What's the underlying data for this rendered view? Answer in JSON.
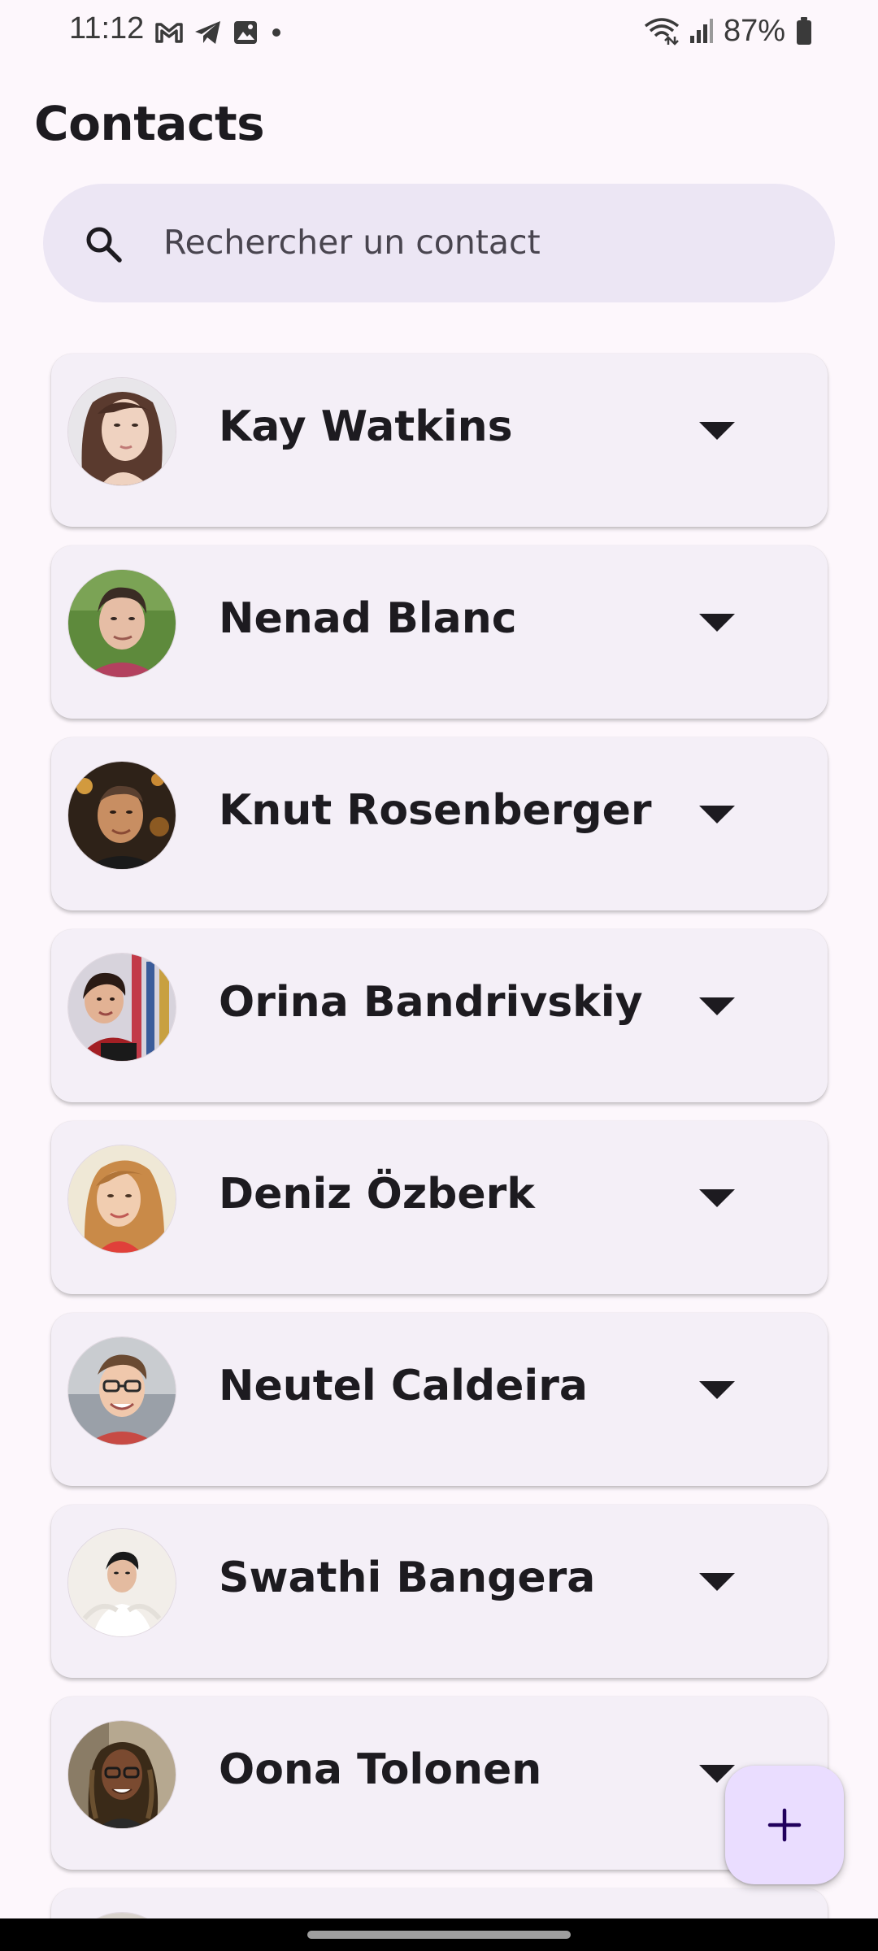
{
  "status_bar": {
    "time": "11:12",
    "battery": "87%",
    "left_icons": [
      "gmail-icon",
      "telegram-icon",
      "gallery-icon",
      "dot-icon"
    ],
    "right_icons": [
      "wifi-icon",
      "signal-icon",
      "battery-icon"
    ]
  },
  "page": {
    "title": "Contacts"
  },
  "search": {
    "placeholder": "Rechercher un contact",
    "icon": "search-icon"
  },
  "contacts": [
    {
      "name": "Kay Watkins"
    },
    {
      "name": "Nenad Blanc"
    },
    {
      "name": "Knut Rosenberger"
    },
    {
      "name": "Orina Bandrivskiy"
    },
    {
      "name": "Deniz Özberk"
    },
    {
      "name": "Neutel Caldeira"
    },
    {
      "name": "Swathi Bangera"
    },
    {
      "name": "Oona Tolonen"
    }
  ],
  "fab": {
    "icon": "plus-icon"
  },
  "colors": {
    "background": "#fdf7fc",
    "search_bg": "#ece6f4",
    "card_bg": "#f4eff7",
    "fab_bg": "#eaddff",
    "fab_icon": "#21005d",
    "text": "#1d1b20"
  }
}
